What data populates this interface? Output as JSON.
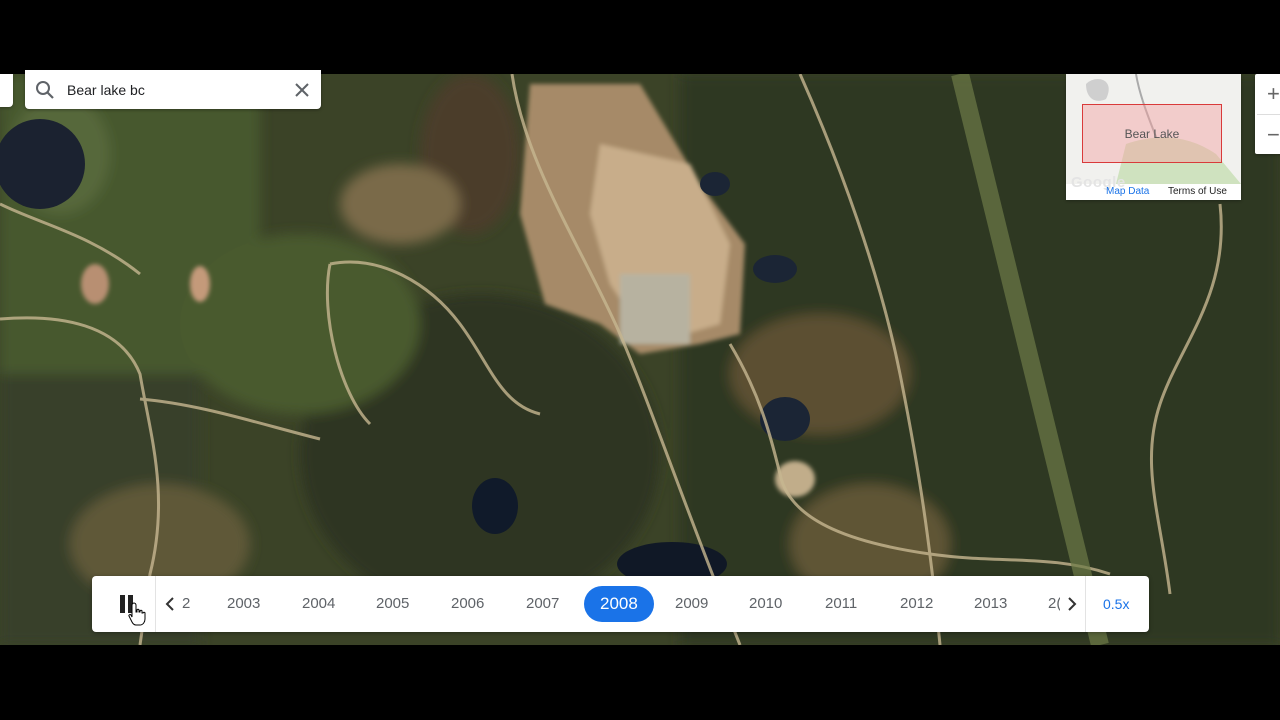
{
  "search": {
    "query": "Bear lake bc"
  },
  "minimap": {
    "place_label": "Bear Lake",
    "map_data_link": "Map Data",
    "terms_link": "Terms of Use",
    "logo_text": "Google"
  },
  "zoom": {
    "in": "+",
    "out": "−"
  },
  "timeline": {
    "partial_left_year": "2",
    "years": [
      "2003",
      "2004",
      "2005",
      "2006",
      "2007",
      "2008",
      "2009",
      "2010",
      "2011",
      "2012",
      "2013"
    ],
    "selected_year": "2008",
    "partial_right_year": "2(",
    "speed": "0.5x"
  },
  "icons": [
    "search-icon",
    "close-icon",
    "pause-icon",
    "chevron-left-icon",
    "chevron-right-icon",
    "plus-icon",
    "minus-icon",
    "pointer-cursor-icon"
  ],
  "colors": {
    "accent": "#1a73e8",
    "highlight_red": "#d93a3a"
  }
}
